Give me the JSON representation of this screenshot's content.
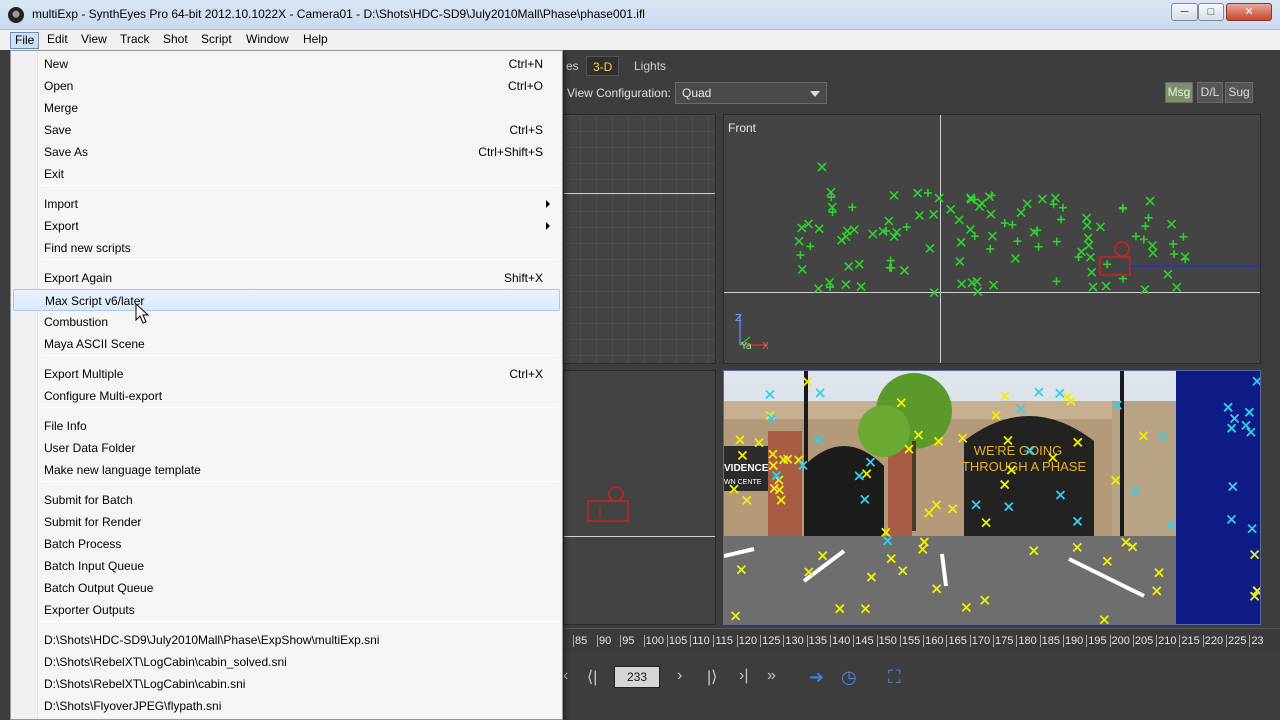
{
  "window": {
    "title": "multiExp - SynthEyes Pro 64-bit 2012.10.1022X - Camera01 - D:\\Shots\\HDC-SD9\\July2010Mall\\Phase\\phase001.ifl",
    "minimize": "─",
    "maximize": "□",
    "close": "✕"
  },
  "menubar": [
    "File",
    "Edit",
    "View",
    "Track",
    "Shot",
    "Script",
    "Window",
    "Help"
  ],
  "workspace": {
    "tabs": [
      "es",
      "3-D",
      "Lights"
    ],
    "active_tab": "3-D",
    "view_config_label": "View Configuration:",
    "view_config_value": "Quad",
    "buttons": [
      "Msg",
      "D/L",
      "Sug"
    ],
    "front_view_label": "Front",
    "axis_labels": {
      "z": "Z",
      "y": "Ya",
      "x": "X"
    },
    "frame": "233",
    "timeline_ticks": [
      "85",
      "90",
      "95",
      "100",
      "105",
      "110",
      "115",
      "120",
      "125",
      "130",
      "135",
      "140",
      "145",
      "150",
      "155",
      "160",
      "165",
      "170",
      "175",
      "180",
      "185",
      "190",
      "195",
      "200",
      "205",
      "210",
      "215",
      "220",
      "225",
      "23"
    ],
    "camera_text": {
      "sign_line1": "WE'RE GOING",
      "sign_line2": "THROUGH A PHASE",
      "store_line1": "VIDENCE",
      "store_line2": "WN CENTE"
    },
    "colors": {
      "tracker_green": "#2fd02f",
      "tracker_yellow": "#f0f000",
      "tracker_cyan": "#30d0f0",
      "camera_red": "#d02020",
      "active_tab_text": "#f3d34a"
    }
  },
  "file_menu": {
    "items": [
      {
        "label": "New",
        "shortcut": "Ctrl+N"
      },
      {
        "label": "Open",
        "shortcut": "Ctrl+O"
      },
      {
        "label": "Merge",
        "shortcut": ""
      },
      {
        "label": "Save",
        "shortcut": "Ctrl+S"
      },
      {
        "label": "Save As",
        "shortcut": "Ctrl+Shift+S"
      },
      {
        "label": "Exit",
        "shortcut": ""
      },
      {
        "label": "Import",
        "shortcut": "",
        "submenu": true
      },
      {
        "label": "Export",
        "shortcut": "",
        "submenu": true
      },
      {
        "label": "Find new scripts",
        "shortcut": ""
      },
      {
        "label": "Export Again",
        "shortcut": "Shift+X"
      },
      {
        "label": "Max Script v6/later",
        "shortcut": "",
        "highlighted": true
      },
      {
        "label": "Combustion",
        "shortcut": ""
      },
      {
        "label": "Maya ASCII Scene",
        "shortcut": ""
      },
      {
        "label": "Export Multiple",
        "shortcut": "Ctrl+X"
      },
      {
        "label": "Configure Multi-export",
        "shortcut": ""
      },
      {
        "label": "File Info",
        "shortcut": ""
      },
      {
        "label": "User Data Folder",
        "shortcut": ""
      },
      {
        "label": "Make new language template",
        "shortcut": ""
      },
      {
        "label": "Submit for Batch",
        "shortcut": ""
      },
      {
        "label": "Submit for Render",
        "shortcut": ""
      },
      {
        "label": "Batch Process",
        "shortcut": ""
      },
      {
        "label": "Batch Input Queue",
        "shortcut": ""
      },
      {
        "label": "Batch Output Queue",
        "shortcut": ""
      },
      {
        "label": "Exporter Outputs",
        "shortcut": ""
      },
      {
        "label": "D:\\Shots\\HDC-SD9\\July2010Mall\\Phase\\ExpShow\\multiExp.sni",
        "shortcut": ""
      },
      {
        "label": "D:\\Shots\\RebelXT\\LogCabin\\cabin_solved.sni",
        "shortcut": ""
      },
      {
        "label": "D:\\Shots\\RebelXT\\LogCabin\\cabin.sni",
        "shortcut": ""
      },
      {
        "label": "D:\\Shots\\FlyoverJPEG\\flypath.sni",
        "shortcut": ""
      }
    ]
  }
}
